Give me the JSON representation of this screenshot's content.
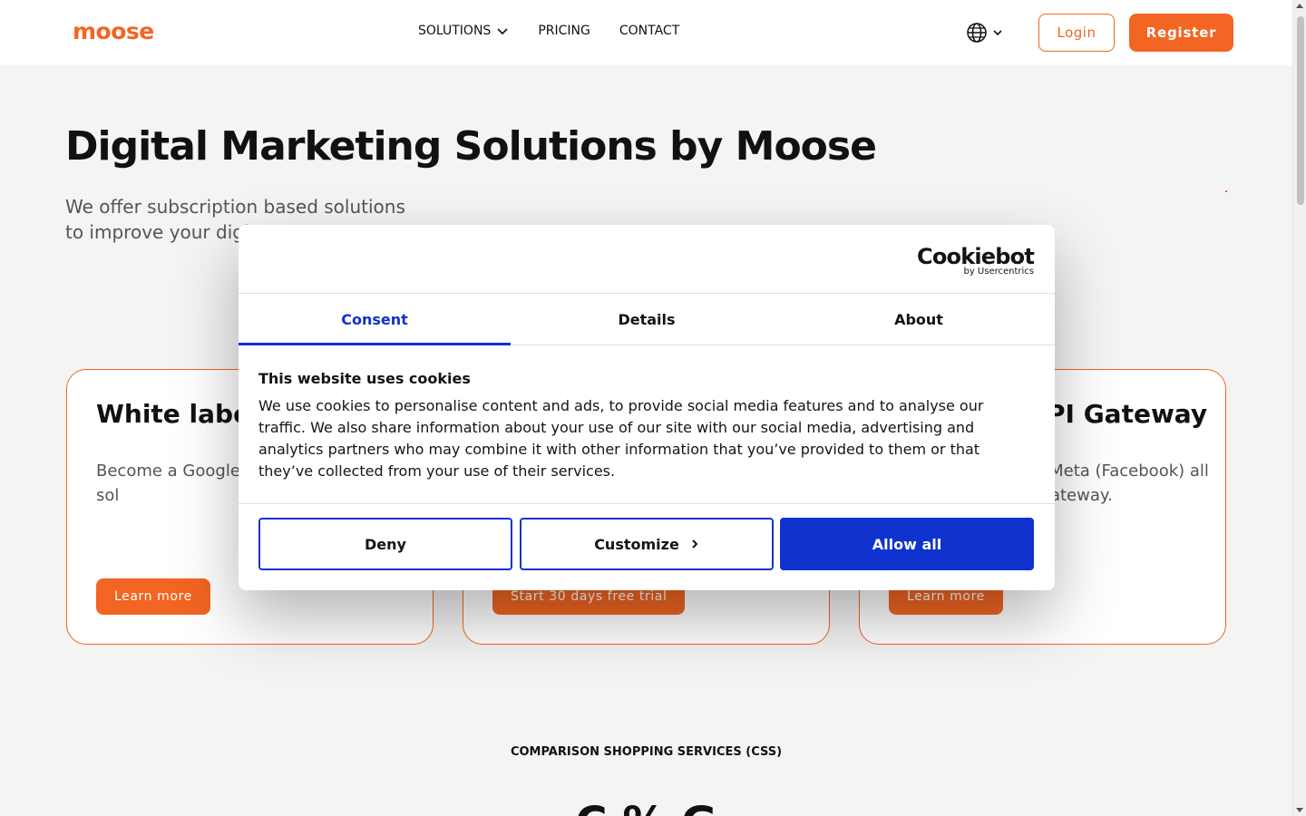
{
  "header": {
    "logo": "moose",
    "nav": [
      {
        "label": "SOLUTIONS",
        "has_dropdown": true
      },
      {
        "label": "PRICING"
      },
      {
        "label": "CONTACT"
      }
    ],
    "login_label": "Login",
    "register_label": "Register"
  },
  "hero": {
    "title": "Digital Marketing Solutions by Moose",
    "subtitle": "We offer subscription based solutions to improve your digit"
  },
  "cards": [
    {
      "title": "White label C",
      "text": "Become a Google C White label CSS sol",
      "button": "Learn more"
    },
    {
      "title": "",
      "text": "",
      "button": "Start 30 days free trial"
    },
    {
      "title": "PI Gateway",
      "text": "r Meta (Facebook) all Gateway.",
      "button": "Learn more"
    }
  ],
  "section": {
    "label": "COMPARISON SHOPPING SERVICES (CSS)",
    "heading": "C          %           G"
  },
  "cookie_dialog": {
    "brand": "Cookiebot",
    "brand_sub": "by Usercentrics",
    "tabs": [
      {
        "label": "Consent",
        "active": true
      },
      {
        "label": "Details",
        "active": false
      },
      {
        "label": "About",
        "active": false
      }
    ],
    "heading": "This website uses cookies",
    "body": "We use cookies to personalise content and ads, to provide social media features and to analyse our traffic. We also share information about your use of our site with our social media, advertising and analytics partners who may combine it with other information that you’ve provided to them or that they’ve collected from your use of their services.",
    "buttons": {
      "deny": "Deny",
      "customize": "Customize",
      "allow_all": "Allow all"
    }
  },
  "colors": {
    "brand_orange": "#f26522",
    "cookie_blue": "#1032cf"
  }
}
